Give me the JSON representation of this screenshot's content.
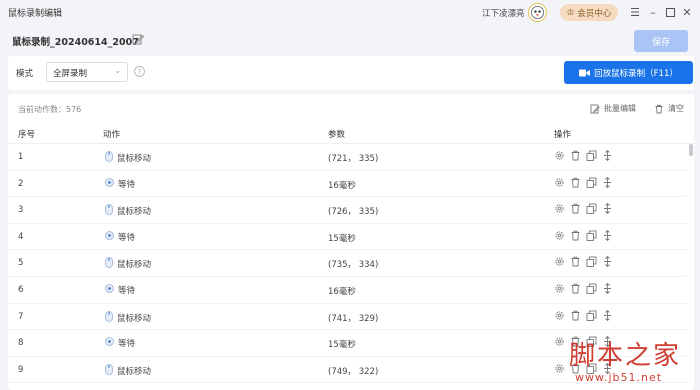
{
  "window": {
    "title": "鼠标录制编辑",
    "user_name": "江下凌漂亮",
    "vip_label": "会员中心"
  },
  "record": {
    "name": "鼠标录制_20240614_2007",
    "save_label": "保存"
  },
  "mode": {
    "label": "模式",
    "selected": "全屏录制",
    "replay_label": "回放鼠标录制（F11）"
  },
  "table": {
    "count_text": "当前动作数：576",
    "batch_edit_label": "批量编辑",
    "clear_label": "清空",
    "headers": {
      "index": "序号",
      "action": "动作",
      "params": "参数",
      "ops": "操作"
    },
    "rows": [
      {
        "index": "1",
        "action": "鼠标移动",
        "icon": "mouse-icon",
        "params": "(721， 335)"
      },
      {
        "index": "2",
        "action": "等待",
        "icon": "clock-icon",
        "params": "16毫秒"
      },
      {
        "index": "3",
        "action": "鼠标移动",
        "icon": "mouse-icon",
        "params": "(726， 335)"
      },
      {
        "index": "4",
        "action": "等待",
        "icon": "clock-icon",
        "params": "15毫秒"
      },
      {
        "index": "5",
        "action": "鼠标移动",
        "icon": "mouse-icon",
        "params": "(735， 334)"
      },
      {
        "index": "6",
        "action": "等待",
        "icon": "clock-icon",
        "params": "16毫秒"
      },
      {
        "index": "7",
        "action": "鼠标移动",
        "icon": "mouse-icon",
        "params": "(741， 329)"
      },
      {
        "index": "8",
        "action": "等待",
        "icon": "clock-icon",
        "params": "15毫秒"
      },
      {
        "index": "9",
        "action": "鼠标移动",
        "icon": "mouse-icon",
        "params": "(749， 322)"
      }
    ]
  },
  "watermark": {
    "title": "脚本之家",
    "url": "www.jb51.net"
  },
  "colors": {
    "accent": "#1a73e8",
    "save_disabled": "#a9c4f5",
    "vip_bg": "#f5dcc0",
    "watermark": "#cc2a1e"
  }
}
